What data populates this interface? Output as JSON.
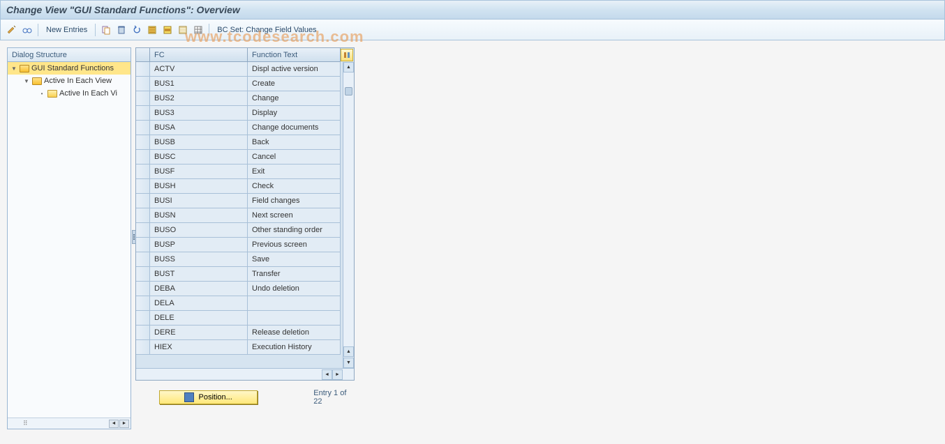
{
  "title": "Change View \"GUI Standard Functions\": Overview",
  "toolbar": {
    "new_entries_label": "New Entries",
    "bcset_label": "BC Set: Change Field Values"
  },
  "watermark": "www.tcodesearch.com",
  "tree": {
    "header": "Dialog Structure",
    "items": [
      {
        "label": "GUI Standard Functions",
        "level": 1,
        "open": true,
        "selected": true
      },
      {
        "label": "Active In Each View",
        "level": 2,
        "open": true,
        "selected": false
      },
      {
        "label": "Active In Each Vi",
        "level": 3,
        "open": false,
        "selected": false
      }
    ]
  },
  "table": {
    "columns": {
      "fc": "FC",
      "ft": "Function Text"
    },
    "rows": [
      {
        "fc": "ACTV",
        "ft": "Displ active version"
      },
      {
        "fc": "BUS1",
        "ft": "Create"
      },
      {
        "fc": "BUS2",
        "ft": "Change"
      },
      {
        "fc": "BUS3",
        "ft": "Display"
      },
      {
        "fc": "BUSA",
        "ft": "Change documents"
      },
      {
        "fc": "BUSB",
        "ft": "Back"
      },
      {
        "fc": "BUSC",
        "ft": "Cancel"
      },
      {
        "fc": "BUSF",
        "ft": "Exit"
      },
      {
        "fc": "BUSH",
        "ft": "Check"
      },
      {
        "fc": "BUSI",
        "ft": "Field changes"
      },
      {
        "fc": "BUSN",
        "ft": "Next screen"
      },
      {
        "fc": "BUSO",
        "ft": "Other standing order"
      },
      {
        "fc": "BUSP",
        "ft": "Previous screen"
      },
      {
        "fc": "BUSS",
        "ft": "Save"
      },
      {
        "fc": "BUST",
        "ft": "Transfer"
      },
      {
        "fc": "DEBA",
        "ft": "Undo deletion"
      },
      {
        "fc": "DELA",
        "ft": ""
      },
      {
        "fc": "DELE",
        "ft": ""
      },
      {
        "fc": "DERE",
        "ft": "Release deletion"
      },
      {
        "fc": "HIEX",
        "ft": "Execution History"
      }
    ]
  },
  "footer": {
    "position_label": "Position...",
    "entry_text": "Entry 1 of 22"
  }
}
